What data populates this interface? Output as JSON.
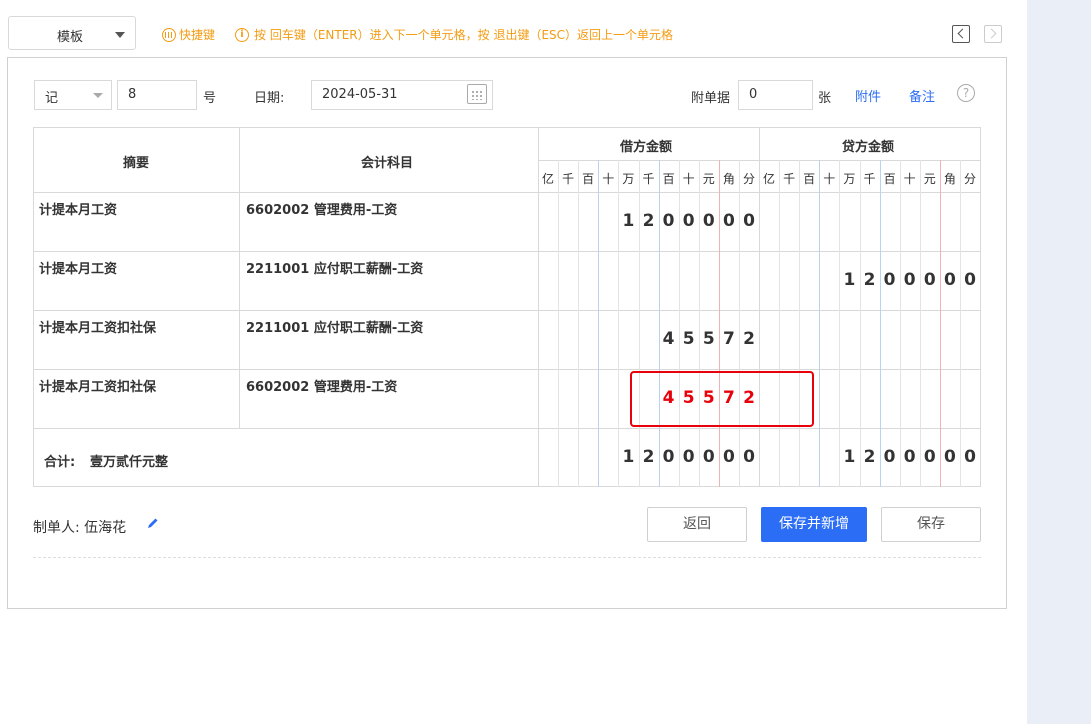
{
  "toolbar": {
    "template_label": "模板",
    "shortcut_label": "快捷键",
    "hint": "按 回车键（ENTER）进入下一个单元格，按 退出键（ESC）返回上一个单元格"
  },
  "voucher": {
    "type": "记",
    "number": "8",
    "number_suffix": "号",
    "date_label": "日期:",
    "date": "2024-05-31",
    "attach_label": "附单据",
    "attach_count": "0",
    "attach_unit": "张",
    "attach_link": "附件",
    "note_link": "备注",
    "help": "?"
  },
  "table": {
    "col_summary": "摘要",
    "col_account": "会计科目",
    "col_debit": "借方金额",
    "col_credit": "贷方金额",
    "units": [
      "亿",
      "千",
      "百",
      "十",
      "万",
      "千",
      "百",
      "十",
      "元",
      "角",
      "分"
    ],
    "rows": [
      {
        "summary": "计提本月工资",
        "account": "6602002 管理费用-工资",
        "debit": "1200000",
        "credit": ""
      },
      {
        "summary": "计提本月工资",
        "account": "2211001 应付职工薪酬-工资",
        "debit": "",
        "credit": "1200000"
      },
      {
        "summary": "计提本月工资扣社保",
        "account": "2211001 应付职工薪酬-工资",
        "debit": "45572",
        "credit": ""
      },
      {
        "summary": "计提本月工资扣社保",
        "account": "6602002 管理费用-工资",
        "debit": "45572",
        "credit": ""
      }
    ],
    "total_label": "合计:",
    "total_words": "壹万贰仟元整",
    "total_debit": "1200000",
    "total_credit": "1200000"
  },
  "footer": {
    "maker_label": "制单人:",
    "maker_name": "伍海花",
    "btn_back": "返回",
    "btn_save_new": "保存并新增",
    "btn_save": "保存"
  },
  "colors": {
    "accent": "#2b6df5",
    "warning": "#f39c12",
    "error": "#e8000b"
  }
}
